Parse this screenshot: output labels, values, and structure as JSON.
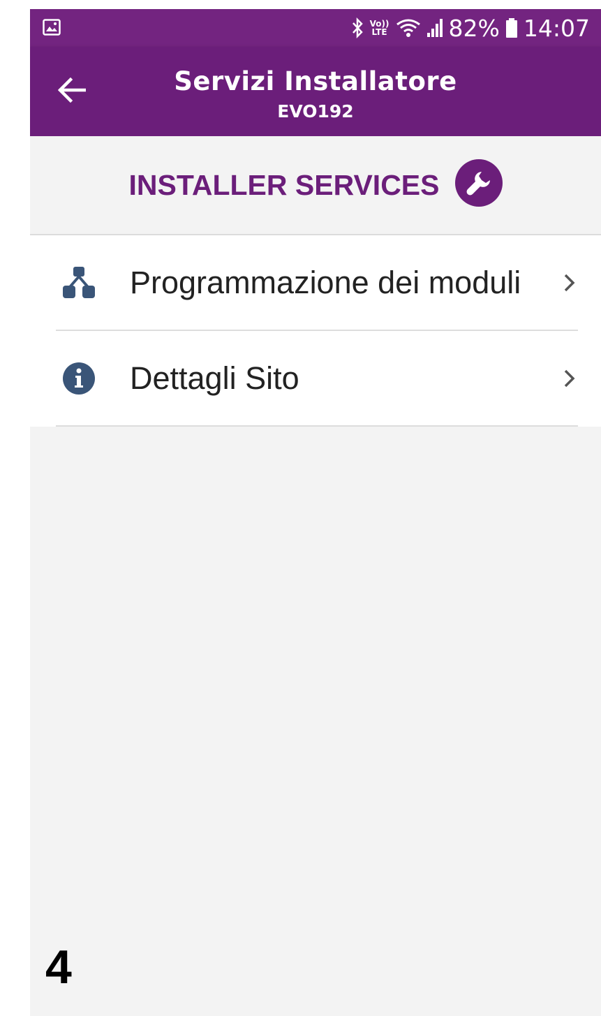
{
  "status_bar": {
    "left_icon": "image-icon",
    "icons": [
      "bluetooth-icon",
      "volte-lte-icon",
      "wifi-icon",
      "signal-icon",
      "battery-icon"
    ],
    "lte_top": "Vo))",
    "lte_bottom": "LTE",
    "battery": "82%",
    "time": "14:07"
  },
  "app_bar": {
    "back_icon": "arrow-left-icon",
    "title": "Servizi Installatore",
    "subtitle": "EVO192"
  },
  "section": {
    "title": "INSTALLER SERVICES",
    "icon": "wrench-icon"
  },
  "menu": {
    "items": [
      {
        "label": "Programmazione dei moduli",
        "icon": "modules-hierarchy-icon"
      },
      {
        "label": "Dettagli Sito",
        "icon": "info-icon"
      }
    ]
  },
  "footer": {
    "page_number": "4"
  },
  "colors": {
    "status_bar": "#732480",
    "app_bar": "#6b1e7a",
    "accent": "#6b1e7a",
    "menu_icon": "#3a5578",
    "background": "#f3f3f3"
  }
}
